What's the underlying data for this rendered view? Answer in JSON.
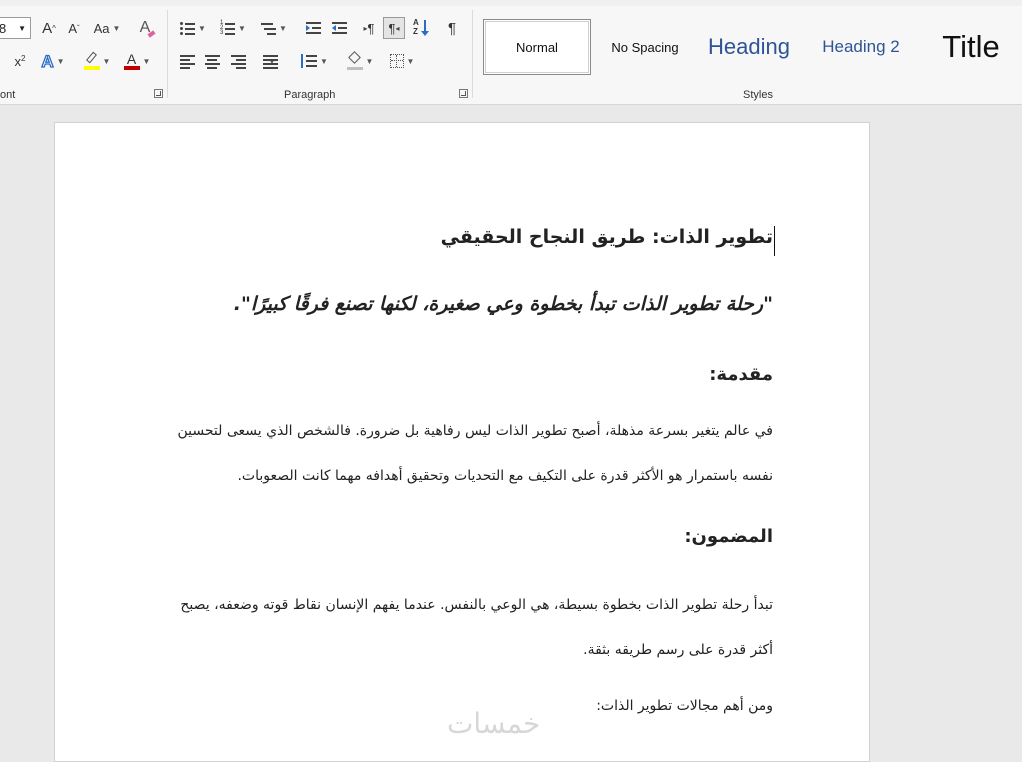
{
  "ribbon": {
    "font": {
      "font_size_value": "8",
      "grow_font": "A",
      "shrink_font": "A",
      "change_case": "Aa",
      "clear_formatting": "A",
      "superscript": "x",
      "text_effects": "A",
      "font_color": "A",
      "group_label": "ont"
    },
    "paragraph": {
      "rtl_ltr_left": "¶",
      "rtl_ltr_right": "¶",
      "sort": "A↓Z",
      "show_marks": "¶",
      "group_label": "Paragraph"
    },
    "styles": {
      "items": [
        {
          "label": "Normal"
        },
        {
          "label": "No Spacing"
        },
        {
          "label": "Heading"
        },
        {
          "label": "Heading 2"
        },
        {
          "label": "Title"
        }
      ],
      "group_label": "Styles"
    },
    "colors": {
      "highlight": "#ffff00",
      "font_color": "#c00000",
      "heading": "#2f5496"
    }
  },
  "document": {
    "title": "تطوير الذات: طريق النجاح الحقيقي",
    "quote": "\"رحلة تطوير الذات تبدأ بخطوة وعي صغيرة، لكنها تصنع فرقًا كبيرًا\".",
    "intro_heading": "مقدمة:",
    "intro_line1": "في عالم يتغير بسرعة مذهلة، أصبح تطوير الذات ليس رفاهية بل ضرورة. فالشخص الذي يسعى لتحسين",
    "intro_line2": "نفسه باستمرار هو الأكثر قدرة على التكيف مع التحديات وتحقيق أهدافه مهما كانت الصعوبات.",
    "content_heading": "المضمون:",
    "content_line1": "تبدأ رحلة تطوير الذات بخطوة بسيطة، هي الوعي بالنفس. عندما يفهم الإنسان نقاط قوته وضعفه، يصبح",
    "content_line2": "أكثر قدرة على رسم طريقه بثقة.",
    "areas_line": "ومن أهم مجالات تطوير الذات:"
  },
  "watermark": "خمسات"
}
